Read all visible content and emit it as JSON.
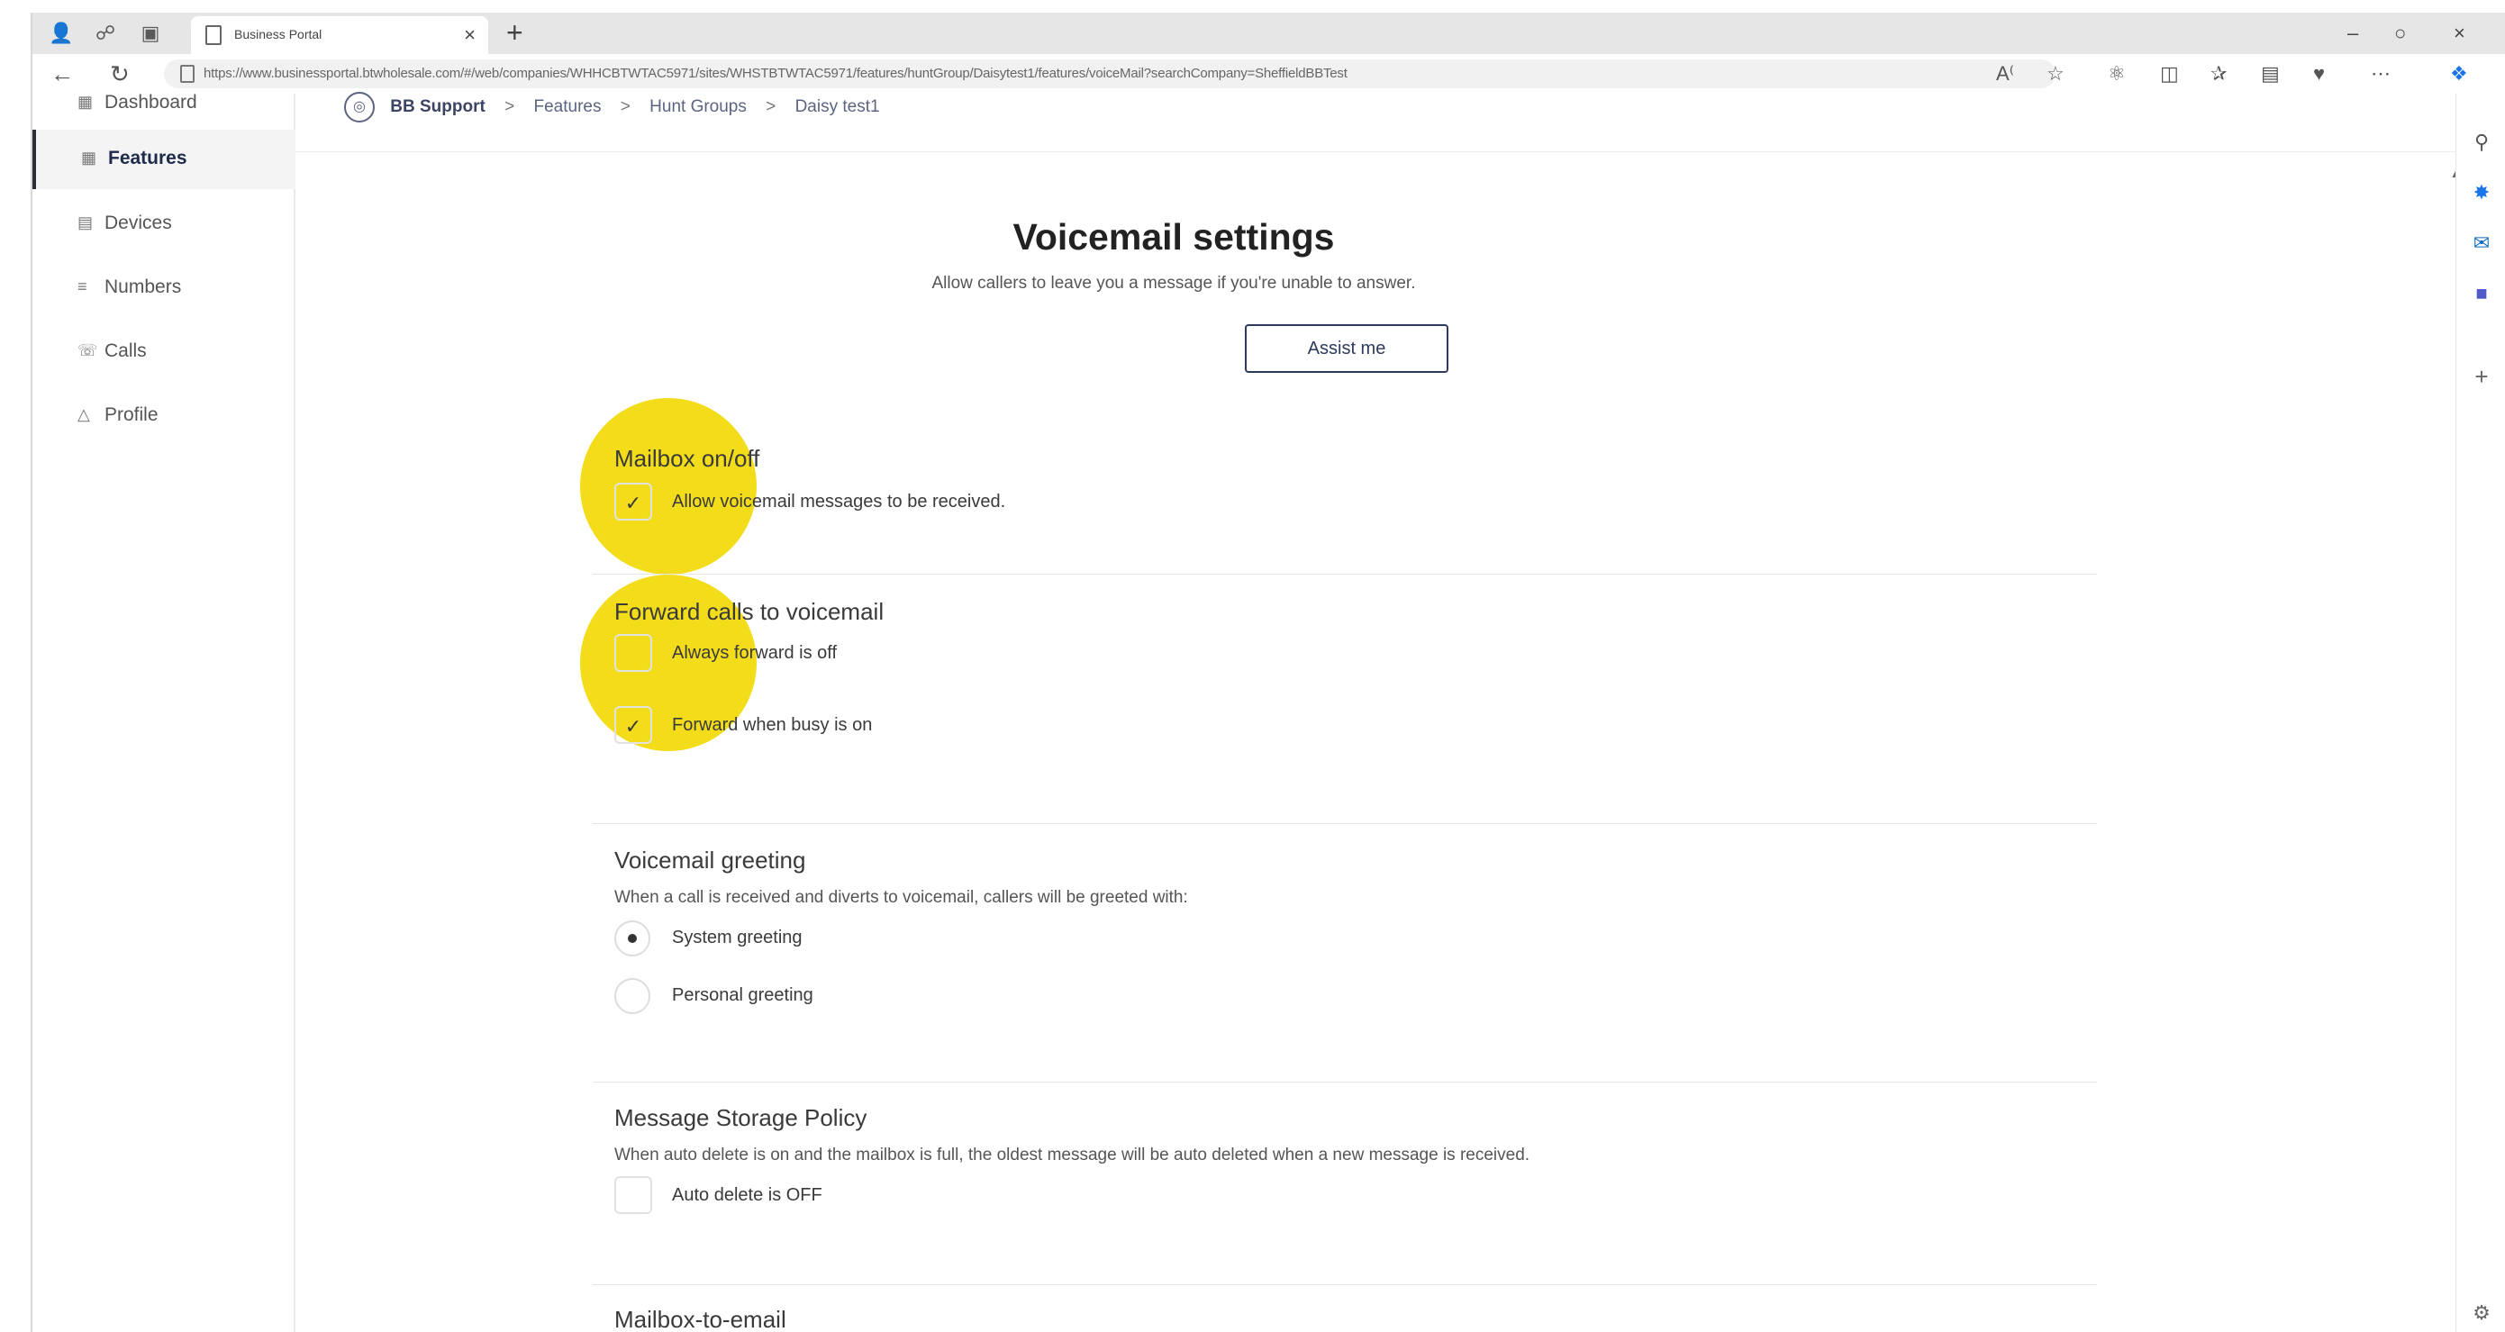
{
  "browser": {
    "tab_title": "Business Portal",
    "url": "https://www.businessportal.btwholesale.com/#/web/companies/WHHCBTWTAC5971/sites/WHSTBTWTAC5971/features/huntGroup/Daisytest1/features/voiceMail?searchCompany=SheffieldBBTest",
    "read_aloud_label": "A)"
  },
  "nav": {
    "items": [
      {
        "label": "Dashboard",
        "icon": "grid-icon"
      },
      {
        "label": "Features",
        "icon": "grid-icon"
      },
      {
        "label": "Devices",
        "icon": "devices-icon"
      },
      {
        "label": "Numbers",
        "icon": "numbers-icon"
      },
      {
        "label": "Calls",
        "icon": "calls-icon"
      },
      {
        "label": "Profile",
        "icon": "profile-icon"
      }
    ],
    "active": "Features"
  },
  "breadcrumb": {
    "items": [
      "BB Support",
      "Features",
      "Hunt Groups",
      "Daisy test1"
    ],
    "separator": ">"
  },
  "page": {
    "title": "Voicemail settings",
    "subtitle": "Allow callers to leave you a message if you're unable to answer.",
    "assist_button": "Assist me"
  },
  "mailbox": {
    "title": "Mailbox on/off",
    "allow_label": "Allow voicemail messages to be received.",
    "allow_checked": true
  },
  "forward": {
    "title": "Forward calls to voicemail",
    "always_label": "Always forward is off",
    "always_checked": false,
    "busy_label": "Forward when busy is on",
    "busy_checked": true
  },
  "greeting": {
    "title": "Voicemail greeting",
    "description": "When a call is received and diverts to voicemail, callers will be greeted with:",
    "options": [
      {
        "label": "System greeting",
        "selected": true
      },
      {
        "label": "Personal greeting",
        "selected": false
      }
    ]
  },
  "storage": {
    "title": "Message Storage Policy",
    "description": "When auto delete is on and the mailbox is full, the oldest message will be auto deleted when a new message is received.",
    "auto_delete_label": "Auto delete is OFF",
    "auto_delete_checked": false
  },
  "email": {
    "title": "Mailbox-to-email"
  },
  "colors": {
    "highlight": "#f3dd1b",
    "primary": "#2d3a5c",
    "edge_blue": "#1a73e8",
    "edge_outlook": "#0f6cbd",
    "edge_teams": "#5059c9"
  }
}
